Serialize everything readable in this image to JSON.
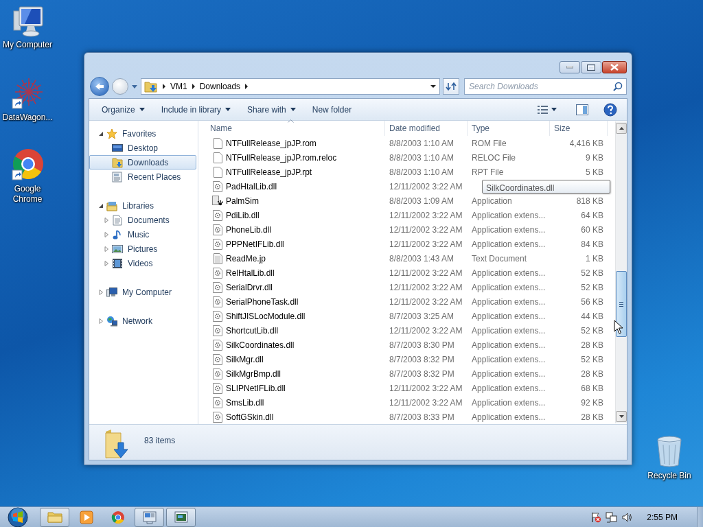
{
  "desktop_icons": [
    {
      "kind": "computer",
      "label": "My Computer"
    },
    {
      "kind": "datawagon",
      "label": "DataWagon..."
    },
    {
      "kind": "chrome",
      "label": "Google Chrome"
    },
    {
      "kind": "recycle",
      "label": "Recycle Bin"
    }
  ],
  "window": {
    "address": [
      "VM1",
      "Downloads"
    ],
    "search": {
      "placeholder": "Search Downloads"
    },
    "toolbar": [
      {
        "label": "Organize",
        "dropdown": true
      },
      {
        "label": "Include in library",
        "dropdown": true
      },
      {
        "label": "Share with",
        "dropdown": true
      },
      {
        "label": "New folder",
        "dropdown": false
      }
    ],
    "nav": [
      {
        "kind": "star",
        "label": "Favorites",
        "expanded": true,
        "selected": false,
        "children": [
          {
            "kind": "desktop",
            "label": "Desktop",
            "selected": false
          },
          {
            "kind": "downloads",
            "label": "Downloads",
            "selected": true
          },
          {
            "kind": "recent",
            "label": "Recent Places",
            "selected": false
          }
        ]
      },
      {
        "kind": "library",
        "label": "Libraries",
        "expanded": true,
        "selected": false,
        "children": [
          {
            "kind": "documents",
            "label": "Documents",
            "expanded": false,
            "selected": false
          },
          {
            "kind": "music",
            "label": "Music",
            "expanded": false,
            "selected": false
          },
          {
            "kind": "pictures",
            "label": "Pictures",
            "expanded": false,
            "selected": false
          },
          {
            "kind": "videos",
            "label": "Videos",
            "expanded": false,
            "selected": false
          }
        ]
      },
      {
        "kind": "computer",
        "label": "My Computer",
        "expanded": false,
        "selected": false
      },
      {
        "kind": "network",
        "label": "Network",
        "expanded": false,
        "selected": false
      }
    ],
    "columns": [
      {
        "label": "Name",
        "sorted": true
      },
      {
        "label": "Date modified",
        "sorted": false
      },
      {
        "label": "Type",
        "sorted": false
      },
      {
        "label": "Size",
        "sorted": false
      }
    ],
    "files": [
      {
        "kind": "blank",
        "name": "NTFullRelease_jpJP.rom",
        "date": "8/8/2003 1:10 AM",
        "type": "ROM File",
        "size": "4,416 KB"
      },
      {
        "kind": "blank",
        "name": "NTFullRelease_jpJP.rom.reloc",
        "date": "8/8/2003 1:10 AM",
        "type": "RELOC File",
        "size": "9 KB"
      },
      {
        "kind": "blank",
        "name": "NTFullRelease_jpJP.rpt",
        "date": "8/8/2003 1:10 AM",
        "type": "RPT File",
        "size": "5 KB"
      },
      {
        "kind": "dll",
        "name": "PadHtalLib.dll",
        "date": "12/11/2002 3:22 AM"
      },
      {
        "kind": "app",
        "name": "PalmSim",
        "date": "8/8/2003 1:09 AM",
        "type": "Application",
        "size": "818 KB"
      },
      {
        "kind": "dll",
        "name": "PdiLib.dll",
        "date": "12/11/2002 3:22 AM",
        "type": "Application extens...",
        "size": "64 KB"
      },
      {
        "kind": "dll",
        "name": "PhoneLib.dll",
        "date": "12/11/2002 3:22 AM",
        "type": "Application extens...",
        "size": "60 KB"
      },
      {
        "kind": "dll",
        "name": "PPPNetIFLib.dll",
        "date": "12/11/2002 3:22 AM",
        "type": "Application extens...",
        "size": "84 KB"
      },
      {
        "kind": "text",
        "name": "ReadMe.jp",
        "date": "8/8/2003 1:43 AM",
        "type": "Text Document",
        "size": "1 KB"
      },
      {
        "kind": "dll",
        "name": "RelHtalLib.dll",
        "date": "12/11/2002 3:22 AM",
        "type": "Application extens...",
        "size": "52 KB"
      },
      {
        "kind": "dll",
        "name": "SerialDrvr.dll",
        "date": "12/11/2002 3:22 AM",
        "type": "Application extens...",
        "size": "52 KB"
      },
      {
        "kind": "dll",
        "name": "SerialPhoneTask.dll",
        "date": "12/11/2002 3:22 AM",
        "type": "Application extens...",
        "size": "56 KB"
      },
      {
        "kind": "dll",
        "name": "ShiftJISLocModule.dll",
        "date": "8/7/2003 3:25 AM",
        "type": "Application extens...",
        "size": "44 KB"
      },
      {
        "kind": "dll",
        "name": "ShortcutLib.dll",
        "date": "12/11/2002 3:22 AM",
        "type": "Application extens...",
        "size": "52 KB"
      },
      {
        "kind": "dll",
        "name": "SilkCoordinates.dll",
        "date": "8/7/2003 8:30 PM",
        "type": "Application extens...",
        "size": "28 KB"
      },
      {
        "kind": "dll",
        "name": "SilkMgr.dll",
        "date": "8/7/2003 8:32 PM",
        "type": "Application extens...",
        "size": "52 KB"
      },
      {
        "kind": "dll",
        "name": "SilkMgrBmp.dll",
        "date": "8/7/2003 8:32 PM",
        "type": "Application extens...",
        "size": "28 KB"
      },
      {
        "kind": "dll",
        "name": "SLIPNetIFLib.dll",
        "date": "12/11/2002 3:22 AM",
        "type": "Application extens...",
        "size": "68 KB"
      },
      {
        "kind": "dll",
        "name": "SmsLib.dll",
        "date": "12/11/2002 3:22 AM",
        "type": "Application extens...",
        "size": "92 KB"
      },
      {
        "kind": "dll",
        "name": "SoftGSkin.dll",
        "date": "8/7/2003 8:33 PM",
        "type": "Application extens...",
        "size": "28 KB"
      }
    ],
    "tooltip": "SilkCoordinates.dll",
    "status": "83 items"
  },
  "taskbar": {
    "items": [
      {
        "kind": "explorer",
        "open": true
      },
      {
        "kind": "media",
        "open": false
      },
      {
        "kind": "chrome",
        "open": false
      },
      {
        "kind": "remote",
        "open": true
      },
      {
        "kind": "console",
        "open": true
      }
    ],
    "clock": "2:55 PM"
  }
}
